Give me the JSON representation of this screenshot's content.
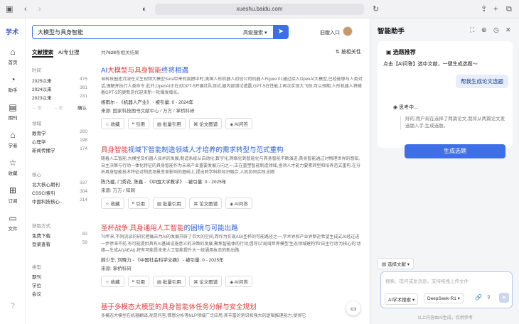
{
  "browser": {
    "url": "xueshu.baidu.com"
  },
  "sidebar": {
    "logo": "学术",
    "items": [
      {
        "label": "首页",
        "icon": "home-icon"
      },
      {
        "label": "助手",
        "icon": "assistant-icon"
      },
      {
        "label": "期刊",
        "icon": "journal-icon"
      },
      {
        "label": "学者",
        "icon": "scholar-icon"
      },
      {
        "label": "收藏",
        "icon": "star-icon"
      },
      {
        "label": "订阅",
        "icon": "subscribe-icon"
      },
      {
        "label": "文件",
        "icon": "folder-icon"
      }
    ]
  },
  "search": {
    "query": "大模型与具身智能",
    "mode": "高级搜索",
    "old_version": "旧版入口"
  },
  "tabs": [
    "文献搜索",
    "AI专业搜"
  ],
  "filters": {
    "time": {
      "title": "时间",
      "rows": [
        {
          "label": "2025以来",
          "count": "475"
        },
        {
          "label": "2024以来",
          "count": "381"
        },
        {
          "label": "2023以来",
          "count": "231"
        }
      ],
      "range_from": "年",
      "range_to": "年",
      "confirm": "确认"
    },
    "field": {
      "title": "领域",
      "rows": [
        {
          "label": "教育学",
          "count": "260"
        },
        {
          "label": "心理学",
          "count": "198"
        },
        {
          "label": "新闻传播学",
          "count": "174"
        }
      ]
    },
    "core": {
      "title": "核心",
      "rows": [
        {
          "label": "北大核心期刊",
          "count": "337"
        },
        {
          "label": "CSSCI索引",
          "count": "304"
        },
        {
          "label": "中国科技核心...",
          "count": "214"
        }
      ]
    },
    "access": {
      "title": "获取方式",
      "rows": [
        {
          "label": "免费下载",
          "count": "82"
        },
        {
          "label": "登录查看",
          "count": "59"
        }
      ]
    },
    "type": {
      "title": "类型",
      "rows": [
        {
          "label": "期刊",
          "count": ""
        },
        {
          "label": "学位",
          "count": ""
        },
        {
          "label": "会议",
          "count": ""
        }
      ]
    }
  },
  "results": {
    "count_prefix": "共",
    "count": "7628",
    "count_suffix": "条相关结果",
    "sort": "按相关性",
    "actions": [
      "收藏",
      "引用",
      "批量引用",
      "论文图谱",
      "AI问答"
    ],
    "items": [
      {
        "title_pre": "AI",
        "title_hl": "大模型与具身智能",
        "title_post": "终将相遇",
        "abstract": "当科技圈还沉浸在文生视频大模型Sora带来的震撼中时,美国人形机器人初创公司机器人Figure 01通过接入OpenAI大模型,已经能够与人类对话,理解并执行人类命令.此外,OpenAI正在对GPT-5开展红队测试,据内部测试透露,GPT-5在性能上再次实现大飞跃,可以预期,人形机器人将随着GPT-5的更新迭代迎来新一轮爆发增长。",
        "authors": "杨雨尔 - 《机器人产业》 - 被引量: 0 - 2024年",
        "source": "来源: 国家科技图书文献中心 / 万方 / 掌桥科研"
      },
      {
        "title_pre": "",
        "title_hl": "具身智能",
        "title_post": "视域下智能制造领域人才培养的需求转型与范式重构",
        "abstract": "随着人工智能,大模型及机器人技术的发展,制造系统从自动化,数字化,网络化到智能化与具身智能不断演进,具身智能通过对物理世界的感知,自主决策与行动一体化特征的具身智能作为未来产业重要发展方向之一,正在重塑智能制造领域,亟须人才能力要素转型和培养范式重构.在分析具身智能技术特征对制造场景变革影响的基础上,提出跨学科和知识融合,人机协同实践,创新",
        "authors": "陈乃建, 门秀花, 陈鑫 - 《中国大学教学》 - 被引量: 0 - 2025年",
        "source": "来源: 万方 / 知网"
      },
      {
        "title_pre": "",
        "title_hl": "圣杯战争:具身通用人工智能",
        "title_post": "的困境与可能出路",
        "abstract": "70年来,不同流派的研究者痛苦为AI的发展开辟了巨大的空间,而作为实现AGI圣杯的可能路径之一,学术界和产业界新近希望生成式AI经过进一步停滞不前,有可能提供具有AI基础设施意义的决策的发展,聚焦智能体的行动,倡导以'局域世界模型'生态领域建构'和'自主行动'为核心的'动缘—生成AI'(AEAI),将有可能是未来人工智能提升大一统通用执态的新出路.",
        "authors": "薛少华, 刘晓力 - 《中国社会科学文摘》 - 被引量: 0 - 2025年",
        "source": "来源: 掌桥科研"
      },
      {
        "title_pre": "",
        "title_hl": "基于多模态大模型的具身智能体任务分解与安全规划",
        "title_post": "",
        "abstract": "多模态大模型在机器翻译,视觉问答,情感分析等NLP领域广泛应用,其丰富的常识和强大的逻辑推理能力,使得它",
        "authors": "",
        "source": ""
      }
    ]
  },
  "assistant": {
    "title": "智能助手",
    "card_title": "选题推荐",
    "card_sub": "点击【AI问答】选中文献，一键生成选题～",
    "user_msg": "帮我生成论文选题",
    "thinking": "思考中...",
    "thinking_text": "好的,用户现在选择了两篇论文,我将从两篇论文发选题入手,生成选题。",
    "generate_btn": "生成选题",
    "select_docs": "选择文献",
    "placeholder": "搜索、提问或发消息。支持拖拽上传文件",
    "chip_mode": "AI学术搜索",
    "chip_model": "DeepSeek-R1",
    "disclaimer": "以上内容由AI生成，仅供参考"
  }
}
